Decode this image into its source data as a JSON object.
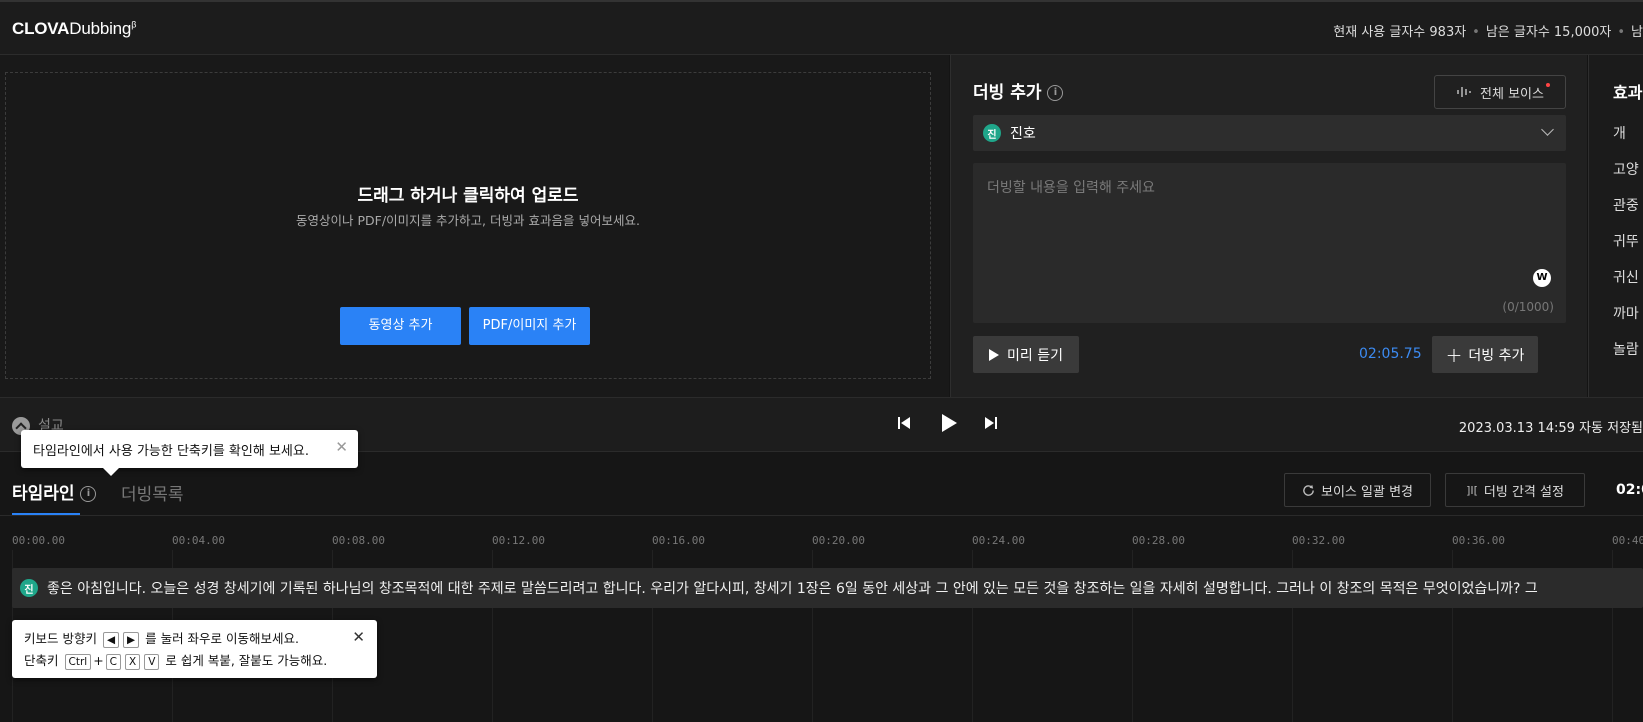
{
  "app": {
    "logo_bold": "CLOVA",
    "logo_light": "Dubbing",
    "logo_sup": "β"
  },
  "usage": {
    "used": "현재 사용 글자수 983자",
    "remaining": "남은 글자수 15,000자",
    "cut": "남"
  },
  "upload": {
    "title": "드래그 하거나 클릭하여 업로드",
    "subtitle": "동영상이나 PDF/이미지를 추가하고, 더빙과 효과음을 넣어보세요.",
    "video_btn": "동영상 추가",
    "pdf_btn": "PDF/이미지 추가"
  },
  "dubbing": {
    "title": "더빙 추가",
    "all_voice": "전체 보이스",
    "voice_avatar": "진",
    "voice_name": "진호",
    "placeholder": "더빙할 내용을 입력해 주세요",
    "w_badge": "W",
    "char_count": "(0/1000)",
    "preview": "미리 듣기",
    "duration": "02:05.75",
    "add": "더빙 추가"
  },
  "sfx": {
    "title": "효과",
    "items": [
      "개",
      "고양",
      "관중",
      "귀뚜",
      "귀신",
      "까마",
      "놀람"
    ]
  },
  "transport": {
    "project_name": "설교",
    "saved": "2023.03.13 14:59 자동 저장됨"
  },
  "tooltips": {
    "shortcut_tip": "타임라인에서 사용 가능한 단축키를 확인해 보세요.",
    "kb_line1_a": "키보드 방향키",
    "kb_line1_b": "를 눌러 좌우로 이동해보세요.",
    "kb_line2_a": "단축키",
    "kb_line2_b": "로 쉽게 복붙, 잘붙도 가능해요.",
    "keys": {
      "left": "◀",
      "right": "▶",
      "ctrl": "Ctrl",
      "plus": "+",
      "c": "C",
      "x": "X",
      "v": "V"
    }
  },
  "timeline": {
    "tab_timeline": "타임라인",
    "tab_list": "더빙목록",
    "bulk_voice": "보이스 일괄 변경",
    "interval": "더빙 간격 설정",
    "right_time": "02:0",
    "ticks": [
      "00:00.00",
      "00:04.00",
      "00:08.00",
      "00:12.00",
      "00:16.00",
      "00:20.00",
      "00:24.00",
      "00:28.00",
      "00:32.00",
      "00:36.00",
      "00:40."
    ],
    "clip_avatar": "진",
    "clip_text": "좋은 아침입니다. 오늘은 성경 창세기에 기록된 하나님의 창조목적에 대한 주제로 말씀드리려고 합니다. 우리가 알다시피, 창세기 1장은 6일 동안 세상과 그 안에 있는 모든 것을 창조하는 일을 자세히 설명합니다. 그러나 이 창조의 목적은 무엇이었습니까? 그"
  },
  "colors": {
    "accent": "#2a82f6",
    "avatar": "#1fa68a",
    "duration": "#3c8bf2"
  }
}
